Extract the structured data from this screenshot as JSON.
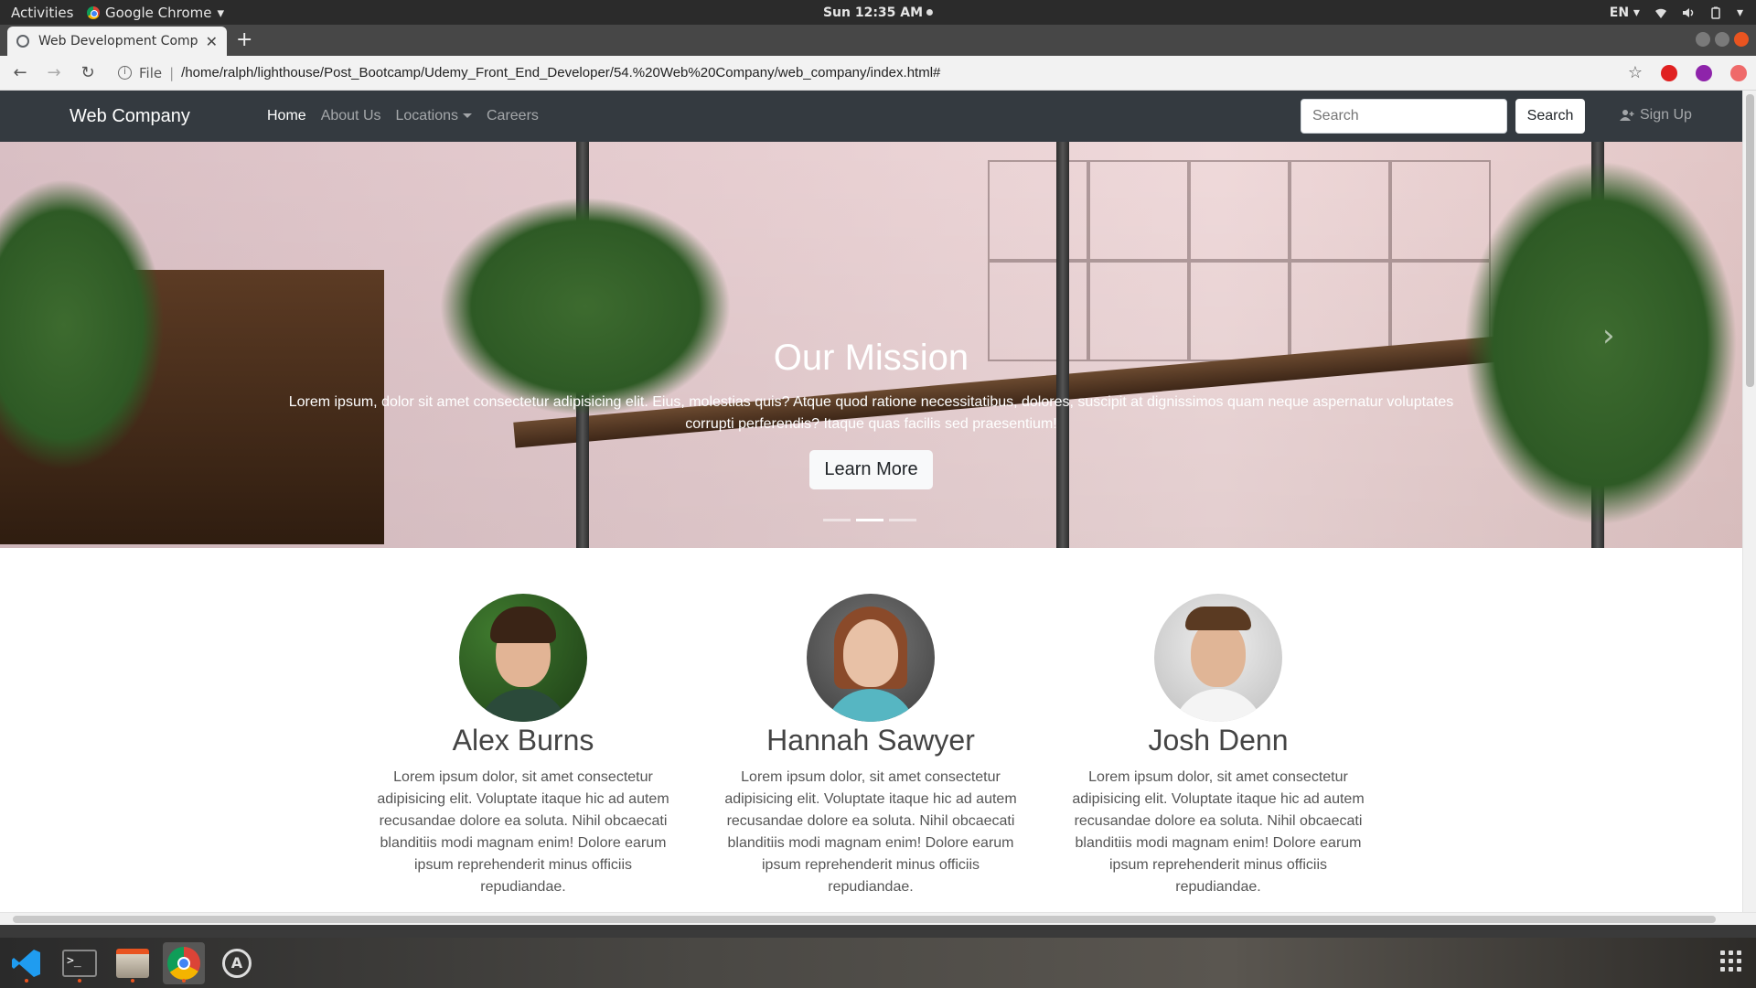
{
  "os": {
    "activities": "Activities",
    "app_menu": "Google Chrome",
    "clock": "Sun 12:35 AM",
    "language": "EN"
  },
  "browser": {
    "tab_title": "Web Development Compa",
    "url_scheme": "File",
    "url": "/home/ralph/lighthouse/Post_Bootcamp/Udemy_Front_End_Developer/54.%20Web%20Company/web_company/index.html#"
  },
  "site": {
    "brand": "Web Company",
    "nav": {
      "home": "Home",
      "about": "About Us",
      "locations": "Locations",
      "careers": "Careers"
    },
    "search_placeholder": "Search",
    "search_button": "Search",
    "signup": "Sign Up"
  },
  "hero": {
    "title": "Our Mission",
    "text": "Lorem ipsum, dolor sit amet consectetur adipisicing elit. Eius, molestias quis? Atque quod ratione necessitatibus, dolores, suscipit at dignissimos quam neque aspernatur voluptates corrupti perferendis? Itaque quas facilis sed praesentium!",
    "button": "Learn More",
    "active_slide": 2,
    "slide_count": 3
  },
  "team": [
    {
      "name": "Alex Burns",
      "bio": "Lorem ipsum dolor, sit amet consectetur adipisicing elit. Voluptate itaque hic ad autem recusandae dolore ea soluta. Nihil obcaecati blanditiis modi magnam enim! Dolore earum ipsum reprehenderit minus officiis repudiandae."
    },
    {
      "name": "Hannah Sawyer",
      "bio": "Lorem ipsum dolor, sit amet consectetur adipisicing elit. Voluptate itaque hic ad autem recusandae dolore ea soluta. Nihil obcaecati blanditiis modi magnam enim! Dolore earum ipsum reprehenderit minus officiis repudiandae."
    },
    {
      "name": "Josh Denn",
      "bio": "Lorem ipsum dolor, sit amet consectetur adipisicing elit. Voluptate itaque hic ad autem recusandae dolore ea soluta. Nihil obcaecati blanditiis modi magnam enim! Dolore earum ipsum reprehenderit minus officiis repudiandae."
    }
  ],
  "dock": [
    "vscode-icon",
    "terminal-icon",
    "files-icon",
    "chrome-icon",
    "software-updater-icon"
  ],
  "colors": {
    "navbar": "#343a40",
    "dock_accent": "#e95420"
  }
}
